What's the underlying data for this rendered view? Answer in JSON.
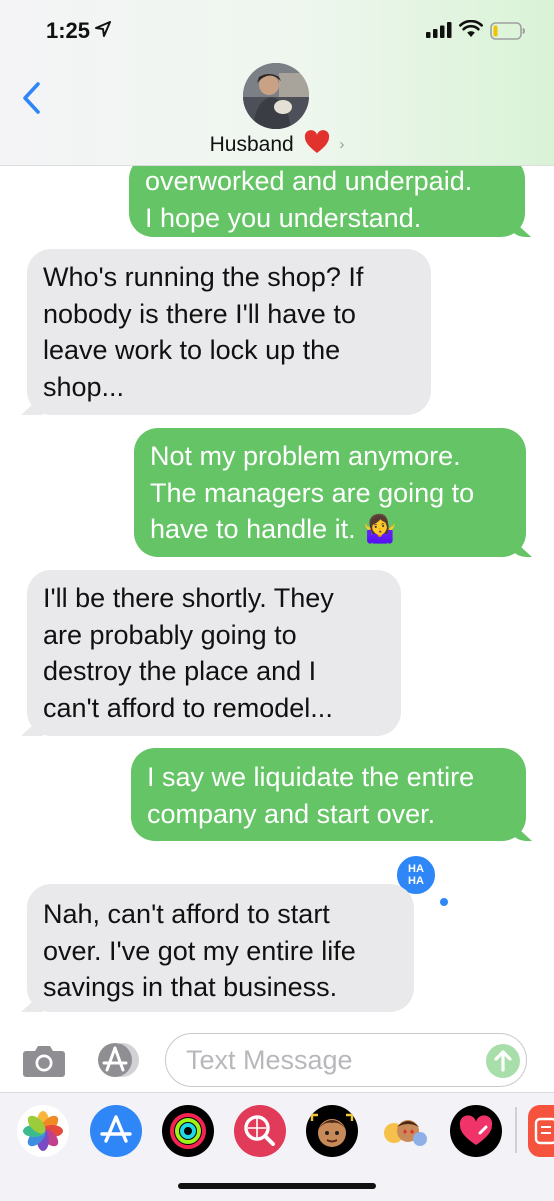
{
  "status_bar": {
    "time": "1:25"
  },
  "header": {
    "contact_name": "Husband"
  },
  "messages": [
    {
      "direction": "out",
      "text": "overworked and underpaid.\nI hope you understand."
    },
    {
      "direction": "in",
      "text": "Who's running the shop?   If\nnobody is there I'll have to\nleave work to lock up the\nshop..."
    },
    {
      "direction": "out",
      "text": "Not my problem anymore.\nThe managers are going to\nhave to handle it. 🤷‍♀️"
    },
    {
      "direction": "in",
      "text": "I'll be there shortly.   They\nare probably going to\ndestroy the place and I\ncan't afford to remodel..."
    },
    {
      "direction": "out",
      "text": "I say we liquidate the entire\ncompany and start over."
    },
    {
      "direction": "in",
      "text": "Nah, can't afford to start\nover.  I've got my entire life\nsavings in that business."
    }
  ],
  "tapback": {
    "label_top": "HA",
    "label_bottom": "HA"
  },
  "composer": {
    "placeholder": "Text Message"
  },
  "app_drawer": [
    "Photos",
    "App Store",
    "Activity",
    "Web Images",
    "Memoji",
    "Memoji Stickers",
    "Digital Touch",
    "More"
  ],
  "colors": {
    "outgoing": "#65c466",
    "incoming": "#e9e9eb",
    "accent": "#2f86f6"
  }
}
